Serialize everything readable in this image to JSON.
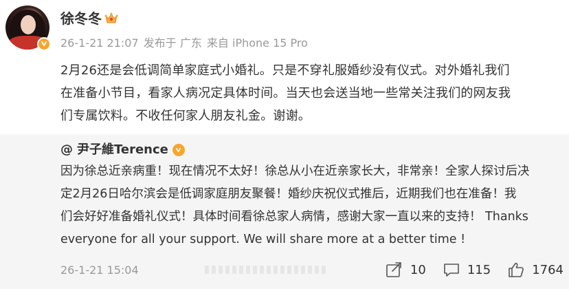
{
  "post": {
    "author": {
      "name": "徐冬冬",
      "avatar_icon": "avatar-image",
      "verified_icon": "verified-badge-icon",
      "crown_icon": "crown-icon"
    },
    "meta": {
      "time": "26-1-21 21:07",
      "location": "发布于 广东",
      "source": "来自 iPhone 15 Pro"
    },
    "text_lines": [
      "2月26还是会低调简单家庭式小婚礼。只是不穿礼服婚纱没有仪式。对外婚礼我们",
      "在准备小节目，看家人病况定具体时间。当天也会送当地一些常关注我们的网友我",
      "们专属饮料。不收任何家人朋友礼金。谢谢。"
    ]
  },
  "repost": {
    "author": {
      "at": "@",
      "name": "尹子維Terence",
      "verified_icon": "verified-badge-icon"
    },
    "text_lines": [
      "因为徐总近亲病重！现在情况不太好！徐总从小在近亲家长大，非常亲！全家人探讨后决",
      "定2月26日哈尔滨会是低调家庭朋友聚餐！婚纱庆祝仪式推后，近期我们也在准备！我",
      "们会好好准备婚礼仪式！具体时间看徐总家人病情，感谢大家一直以来的支持！ Thanks",
      "everyone for all your support.  We will share more at a better time !"
    ],
    "time": "26-1-21 15:04",
    "actions": {
      "repost_count": "10",
      "comment_count": "115",
      "like_count": "1764"
    }
  },
  "colors": {
    "text_primary": "#333333",
    "text_secondary": "#999999",
    "repost_background": "#f5f5f5",
    "verified_orange": "#f7a62c"
  }
}
